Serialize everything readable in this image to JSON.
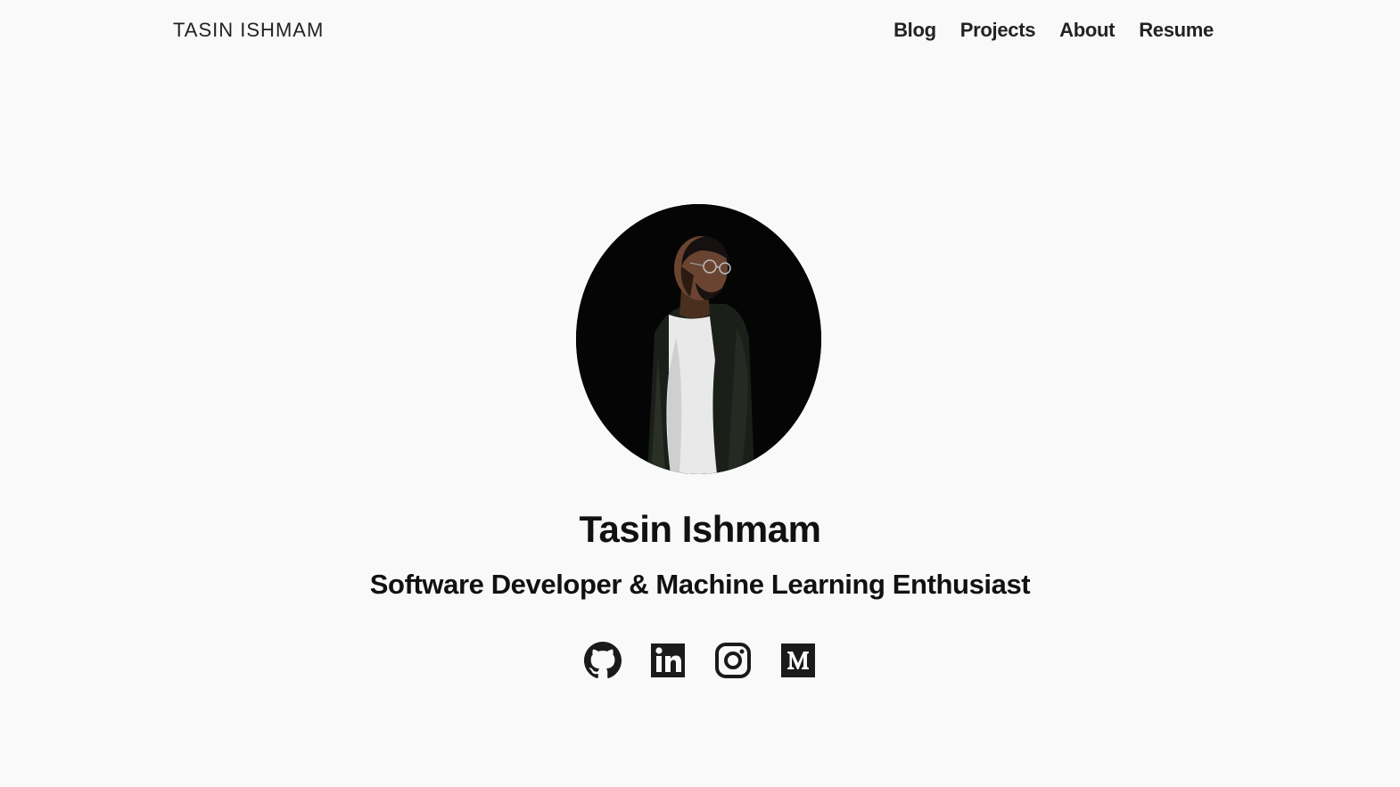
{
  "header": {
    "brand": "TASIN ISHMAM",
    "nav": [
      {
        "label": "Blog"
      },
      {
        "label": "Projects"
      },
      {
        "label": "About"
      },
      {
        "label": "Resume"
      }
    ]
  },
  "hero": {
    "name": "Tasin Ishmam",
    "tagline": "Software Developer & Machine Learning Enthusiast"
  },
  "socials": [
    {
      "icon": "github-icon"
    },
    {
      "icon": "linkedin-icon"
    },
    {
      "icon": "instagram-icon"
    },
    {
      "icon": "medium-icon"
    }
  ],
  "colors": {
    "background": "#f9f9f9",
    "text": "#111111",
    "icon": "#1a1a1a"
  }
}
